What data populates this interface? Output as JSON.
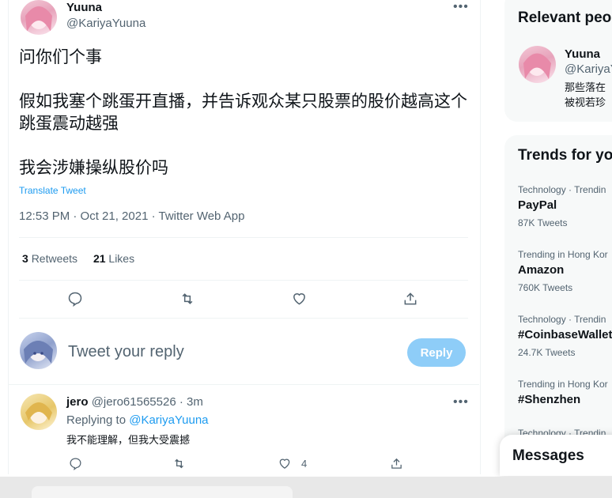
{
  "tweet": {
    "author_name": "Yuuna",
    "author_handle": "@KariyaYuuna",
    "body": "问你们个事\n\n假如我塞个跳蛋开直播，并告诉观众某只股票的股价越高这个跳蛋震动越强\n\n我会涉嫌操纵股价吗",
    "translate_label": "Translate Tweet",
    "meta": "12:53 PM · Oct 21, 2021 · Twitter Web App",
    "retweets_count": "3",
    "retweets_label": "Retweets",
    "likes_count": "21",
    "likes_label": "Likes"
  },
  "composer": {
    "placeholder": "Tweet your reply",
    "reply_button": "Reply"
  },
  "reply": {
    "name": "jero",
    "handle_time": "@jero61565526 · 3m",
    "replying_prefix": "Replying to",
    "replying_handle": "@KariyaYuuna",
    "text": "我不能理解，但我大受震撼",
    "like_count": "4"
  },
  "relevant": {
    "title": "Relevant peo",
    "name": "Yuuna",
    "handle": "@KariyaY",
    "bio": "那些落在\n被视若珍"
  },
  "trends": {
    "title": "Trends for yo",
    "items": [
      {
        "category": "Technology · Trendin",
        "name": "PayPal",
        "count": "87K Tweets"
      },
      {
        "category": "Trending in Hong Kor",
        "name": "Amazon",
        "count": "760K Tweets"
      },
      {
        "category": "Technology · Trendin",
        "name": "#CoinbaseWallet",
        "count": "24.7K Tweets"
      },
      {
        "category": "Trending in Hong Kor",
        "name": "#Shenzhen",
        "count": ""
      },
      {
        "category": "Technology · Trendin",
        "name": "",
        "count": ""
      }
    ]
  },
  "messages": {
    "label": "Messages"
  },
  "colors": {
    "accent": "#1d9bf0",
    "reply_button_disabled": "#8ecdf8",
    "secondary_text": "#536471"
  }
}
